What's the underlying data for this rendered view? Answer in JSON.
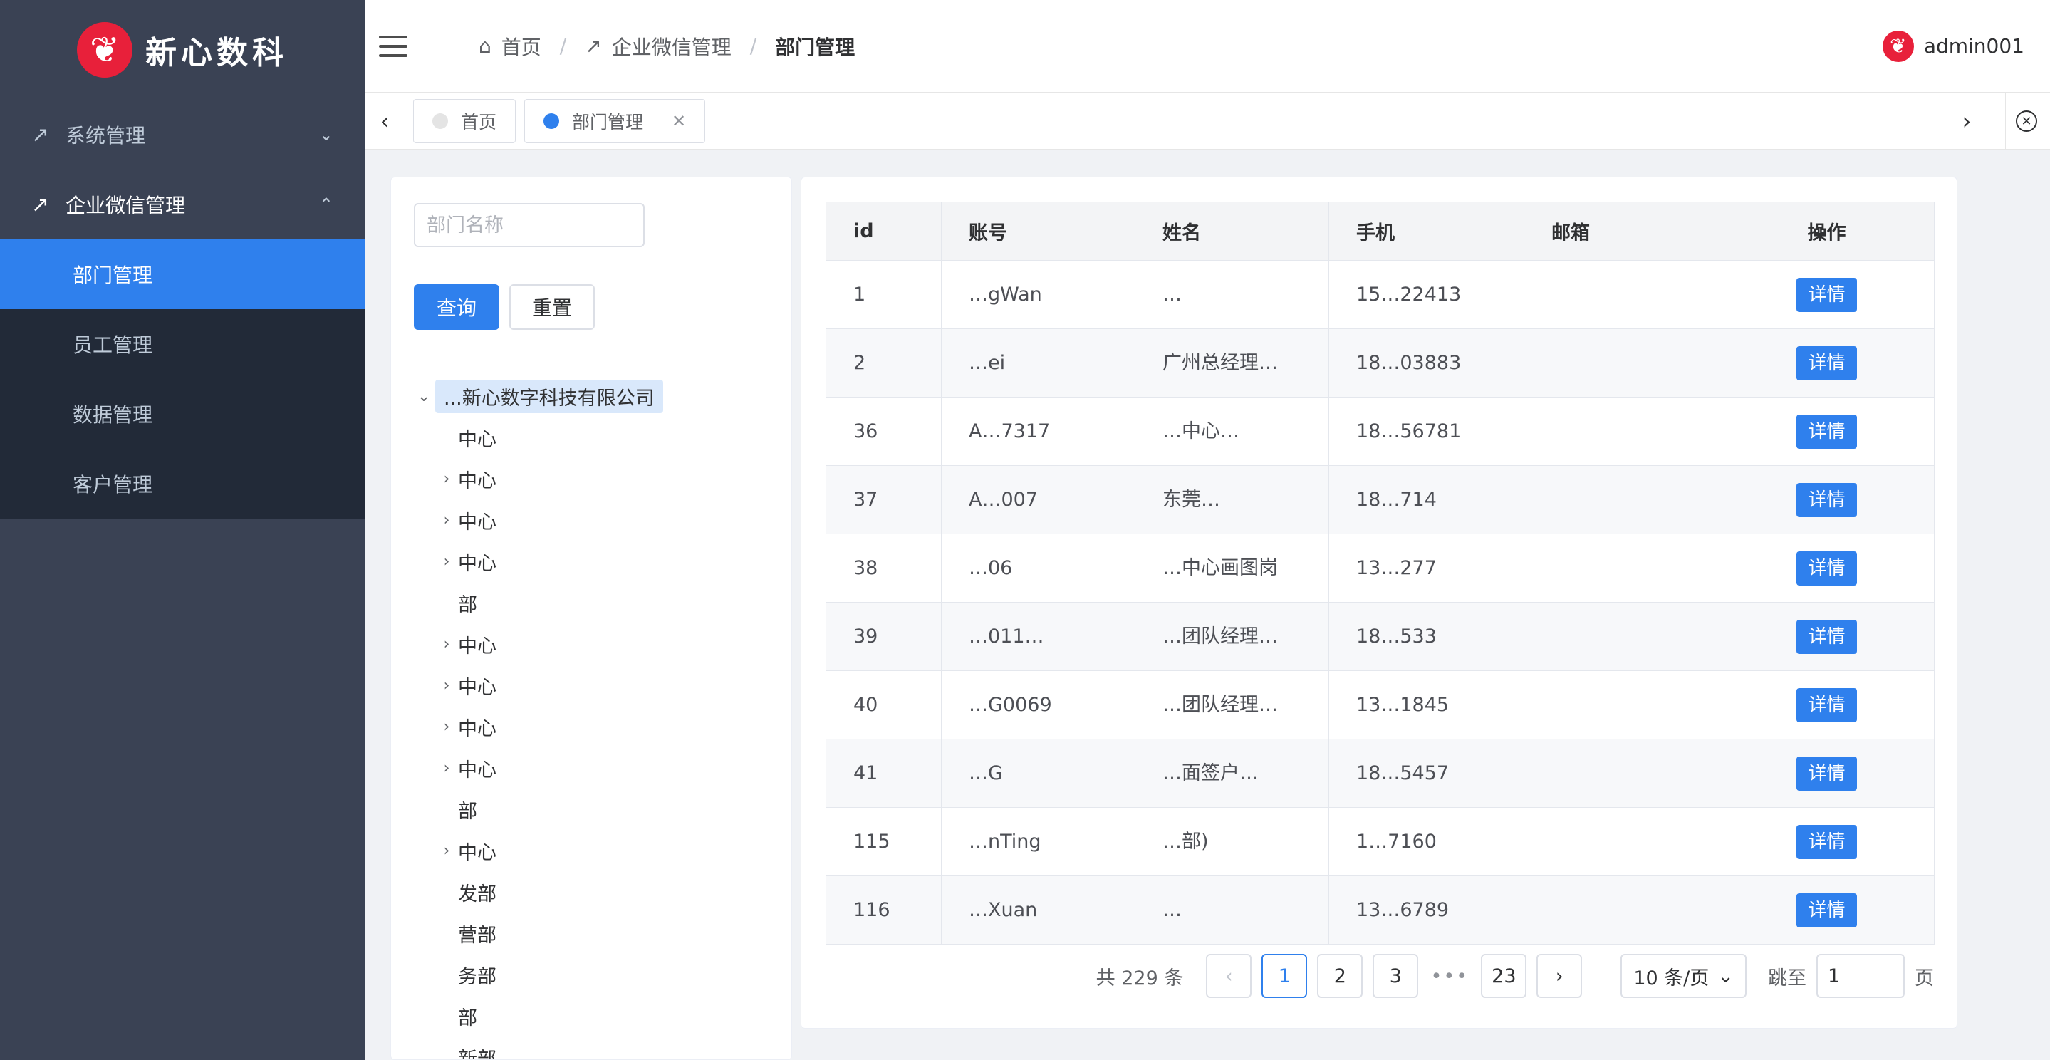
{
  "app": {
    "logo_mark": "❦",
    "logo_text": "新心数科"
  },
  "sidebar": {
    "groups": [
      {
        "label": "系统管理",
        "expanded": false
      },
      {
        "label": "企业微信管理",
        "expanded": true
      }
    ],
    "subitems": [
      "部门管理",
      "员工管理",
      "数据管理",
      "客户管理"
    ],
    "active_subitem": "部门管理"
  },
  "header": {
    "breadcrumb": {
      "home": "首页",
      "parent": "企业微信管理",
      "current": "部门管理",
      "separator": "/"
    },
    "user": {
      "name": "admin001",
      "avatar_glyph": "❦"
    }
  },
  "tags": {
    "items": [
      {
        "label": "首页"
      },
      {
        "label": "部门管理",
        "active": true
      }
    ]
  },
  "left_panel": {
    "search_placeholder": "部门名称",
    "search_value": "",
    "query_label": "查询",
    "reset_label": "重置",
    "tree": {
      "root": "...新心数字科技有限公司",
      "children": [
        {
          "label": "中心",
          "expandable": false
        },
        {
          "label": "中心",
          "expandable": true
        },
        {
          "label": "中心",
          "expandable": true
        },
        {
          "label": "中心",
          "expandable": true
        },
        {
          "label": "部",
          "expandable": false
        },
        {
          "label": "中心",
          "expandable": true
        },
        {
          "label": "中心",
          "expandable": true
        },
        {
          "label": "中心",
          "expandable": true
        },
        {
          "label": "中心",
          "expandable": true
        },
        {
          "label": "部",
          "expandable": false
        },
        {
          "label": "中心",
          "expandable": true
        },
        {
          "label": "发部",
          "expandable": false
        },
        {
          "label": "营部",
          "expandable": false
        },
        {
          "label": "务部",
          "expandable": false
        },
        {
          "label": "部",
          "expandable": false
        },
        {
          "label": "新部",
          "expandable": false
        }
      ]
    }
  },
  "table": {
    "columns": [
      "id",
      "账号",
      "姓名",
      "手机",
      "邮箱",
      "操作"
    ],
    "action_label": "详情",
    "rows": [
      {
        "id": "1",
        "account": "…gWan",
        "name": "…",
        "phone": "15…22413",
        "email": ""
      },
      {
        "id": "2",
        "account": "…ei",
        "name": "广州总经理…",
        "phone": "18…03883",
        "email": ""
      },
      {
        "id": "36",
        "account": "A…7317",
        "name": "…中心…",
        "phone": "18…56781",
        "email": ""
      },
      {
        "id": "37",
        "account": "A…007",
        "name": "东莞…",
        "phone": "18…714",
        "email": ""
      },
      {
        "id": "38",
        "account": "…06",
        "name": "…中心画图岗",
        "phone": "13…277",
        "email": ""
      },
      {
        "id": "39",
        "account": "…011…",
        "name": "…团队经理…",
        "phone": "18…533",
        "email": ""
      },
      {
        "id": "40",
        "account": "…G0069",
        "name": "…团队经理…",
        "phone": "13…1845",
        "email": ""
      },
      {
        "id": "41",
        "account": "…G",
        "name": "…面签户…",
        "phone": "18…5457",
        "email": ""
      },
      {
        "id": "115",
        "account": "…nTing",
        "name": "…部)",
        "phone": "1…7160",
        "email": ""
      },
      {
        "id": "116",
        "account": "…Xuan",
        "name": "…",
        "phone": "13…6789",
        "email": ""
      }
    ]
  },
  "pagination": {
    "total_text": "共 229 条",
    "prev": "‹",
    "next": "›",
    "pages": [
      "1",
      "2",
      "3"
    ],
    "ellipsis": "•••",
    "last_page": "23",
    "current_page": "1",
    "page_size": "10 条/页",
    "jump_label": "跳至",
    "jump_value": "1",
    "page_suffix": "页"
  }
}
